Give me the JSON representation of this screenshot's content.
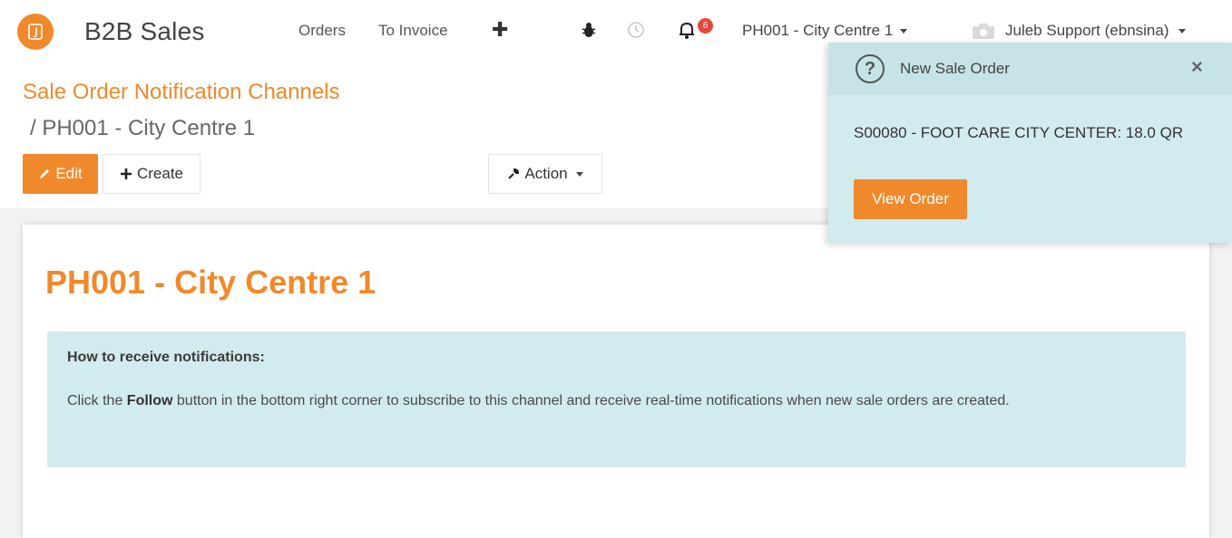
{
  "app": {
    "name": "B2B Sales",
    "logo_icon": "app-logo-icon",
    "brand_color": "#f0892b"
  },
  "nav": {
    "links": [
      "Orders",
      "To Invoice"
    ],
    "plus_icon": "plus-icon",
    "debug_icon": "bug-icon",
    "activity_icon": "clock-icon",
    "notification_icon": "bell-icon",
    "notification_count": "6",
    "company": "PH001 - City Centre 1",
    "user": "Juleb Support (ebnsina)"
  },
  "breadcrumb": {
    "parent": "Sale Order Notification Channels",
    "current": "/ PH001 - City Centre 1"
  },
  "toolbar": {
    "edit_label": "Edit",
    "create_label": "Create",
    "action_label": "Action"
  },
  "record": {
    "title": "PH001 - City Centre 1",
    "info_heading": "How to receive notifications:",
    "info_text_before": "Click the ",
    "info_text_bold": "Follow",
    "info_text_after": " button in the bottom right corner to subscribe to this channel and receive real-time notifications when new sale orders are created."
  },
  "notification": {
    "title": "New Sale Order",
    "body": "S00080 - FOOT CARE CITY CENTER: 18.0 QR",
    "button_label": "View Order",
    "close_symbol": "×",
    "help_symbol": "?"
  }
}
